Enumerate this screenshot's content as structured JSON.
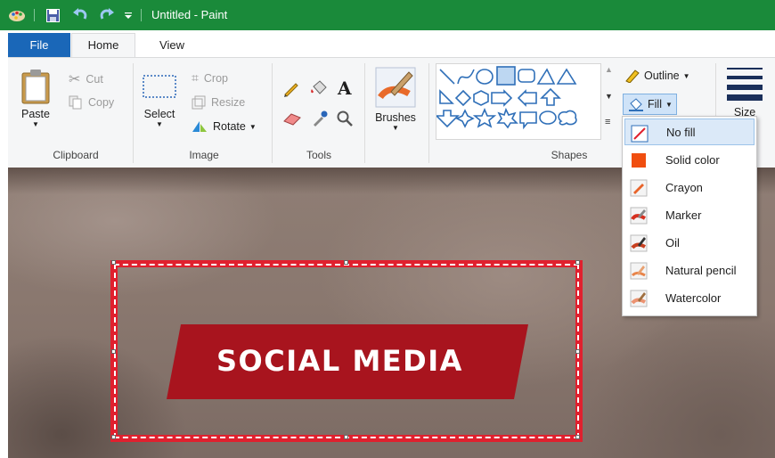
{
  "window": {
    "title": "Untitled - Paint",
    "app_color": "#1a8a3a"
  },
  "quick_access": {
    "icons": [
      "paint-app-icon",
      "save-icon",
      "undo-icon",
      "redo-icon",
      "customize-icon"
    ]
  },
  "tabs": [
    {
      "label": "File"
    },
    {
      "label": "Home"
    },
    {
      "label": "View"
    }
  ],
  "ribbon": {
    "clipboard": {
      "paste": "Paste",
      "cut": "Cut",
      "copy": "Copy",
      "label": "Clipboard"
    },
    "image": {
      "select": "Select",
      "crop": "Crop",
      "resize": "Resize",
      "rotate": "Rotate",
      "label": "Image"
    },
    "tools": {
      "label": "Tools"
    },
    "brushes": {
      "label": "Brushes"
    },
    "shapes": {
      "label": "Shapes",
      "outline": "Outline",
      "fill": "Fill"
    },
    "size": {
      "label": "Size"
    }
  },
  "fill_menu": {
    "items": [
      {
        "label": "No fill",
        "icon": "no-fill-icon"
      },
      {
        "label": "Solid color",
        "icon": "solid-color-icon"
      },
      {
        "label": "Crayon",
        "icon": "crayon-icon"
      },
      {
        "label": "Marker",
        "icon": "marker-icon"
      },
      {
        "label": "Oil",
        "icon": "oil-icon"
      },
      {
        "label": "Natural pencil",
        "icon": "natural-pencil-icon"
      },
      {
        "label": "Watercolor",
        "icon": "watercolor-icon"
      }
    ],
    "selected": "No fill"
  },
  "canvas": {
    "banner_text": "SOCIAL MEDIA",
    "banner_color": "#a8141e",
    "selection_color": "#e0202e"
  }
}
